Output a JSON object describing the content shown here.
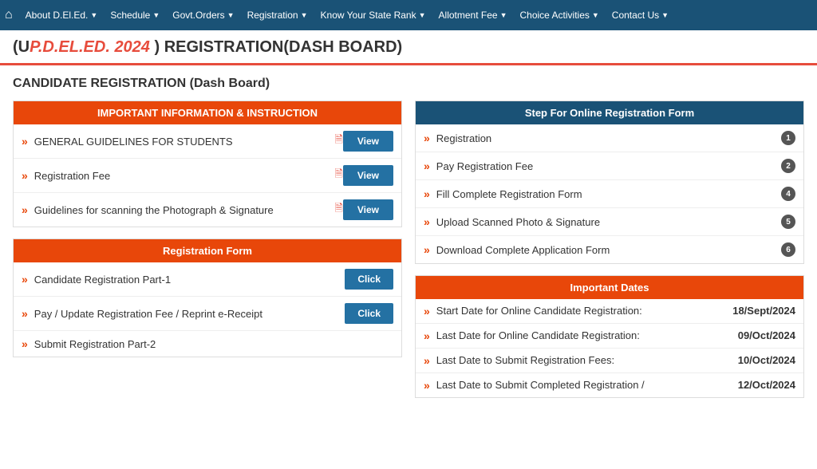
{
  "navbar": {
    "home_icon": "⌂",
    "items": [
      {
        "label": "About D.El.Ed.",
        "arrow": "▼"
      },
      {
        "label": "Schedule",
        "arrow": "▼"
      },
      {
        "label": "Govt.Orders",
        "arrow": "▼"
      },
      {
        "label": "Registration",
        "arrow": "▼"
      },
      {
        "label": "Know Your State Rank",
        "arrow": "▼"
      },
      {
        "label": "Allotment Fee",
        "arrow": "▼"
      },
      {
        "label": "Choice Activities",
        "arrow": "▼"
      },
      {
        "label": "Contact Us",
        "arrow": "▼"
      }
    ]
  },
  "page_title": {
    "prefix": "(U",
    "highlight": "P.D.EL.ED. 2024",
    "suffix": " ) REGISTRATION(DASH BOARD)"
  },
  "section_heading": "CANDIDATE REGISTRATION (Dash Board)",
  "left": {
    "panel1": {
      "header": "IMPORTANT INFORMATION & INSTRUCTION",
      "rows": [
        {
          "text": "GENERAL GUIDELINES FOR STUDENTS",
          "has_icon": true,
          "btn": "View"
        },
        {
          "text": "Registration Fee",
          "has_icon": true,
          "btn": "View"
        },
        {
          "text": "Guidelines for scanning the Photograph & Signature",
          "has_icon": true,
          "btn": "View"
        }
      ]
    },
    "panel2": {
      "header": "Registration Form",
      "rows": [
        {
          "text": "Candidate Registration Part-1",
          "btn": "Click"
        },
        {
          "text": "Pay / Update Registration Fee / Reprint e-Receipt",
          "btn": "Click"
        },
        {
          "text": "Submit Registration Part-2",
          "btn": null
        }
      ]
    }
  },
  "right": {
    "panel1": {
      "header": "Step For Online Registration Form",
      "steps": [
        {
          "text": "Registration",
          "badge": "1"
        },
        {
          "text": "Pay Registration Fee",
          "badge": "2"
        },
        {
          "text": "Fill Complete Registration Form",
          "badge": "4"
        },
        {
          "text": "Upload Scanned Photo & Signature",
          "badge": "5"
        },
        {
          "text": "Download Complete Application Form",
          "badge": "6"
        }
      ]
    },
    "panel2": {
      "header": "Important Dates",
      "dates": [
        {
          "label": "Start Date for Online Candidate Registration:",
          "value": "18/Sept/2024"
        },
        {
          "label": "Last Date for Online Candidate Registration:",
          "value": "09/Oct/2024"
        },
        {
          "label": "Last Date to Submit Registration Fees:",
          "value": "10/Oct/2024"
        },
        {
          "label": "Last Date to Submit Completed Registration /",
          "value": "12/Oct/2024"
        }
      ]
    }
  }
}
